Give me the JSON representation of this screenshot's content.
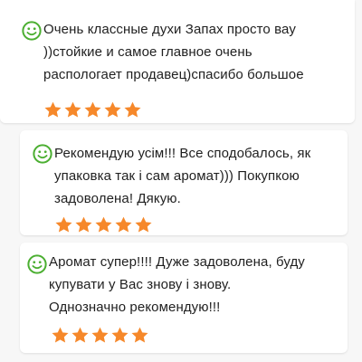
{
  "colors": {
    "star": "#f6882a",
    "smiley": "#4caf32",
    "text": "#1f1f1f",
    "background": "#f7f7f7",
    "card": "#ffffff"
  },
  "icons": {
    "smiley": "smiley-face-icon",
    "star": "star-icon"
  },
  "reviews": [
    {
      "lines": [
        "Очень классные духи Запах просто вау",
        "))стойкие и самое главное очень",
        "распологает продавец)спасибо большое"
      ],
      "rating": 5
    },
    {
      "lines": [
        "Рекомендую усім!!! Все сподобалось, як",
        "упаковка так і сам аромат))) Покупкою",
        "задоволена! Дякую."
      ],
      "rating": 5
    },
    {
      "lines": [
        "Аромат супер!!!! Дуже задоволена, буду",
        "купувати у Вас знову і знову.",
        "Однозначно рекомендую!!!"
      ],
      "rating": 5
    }
  ]
}
